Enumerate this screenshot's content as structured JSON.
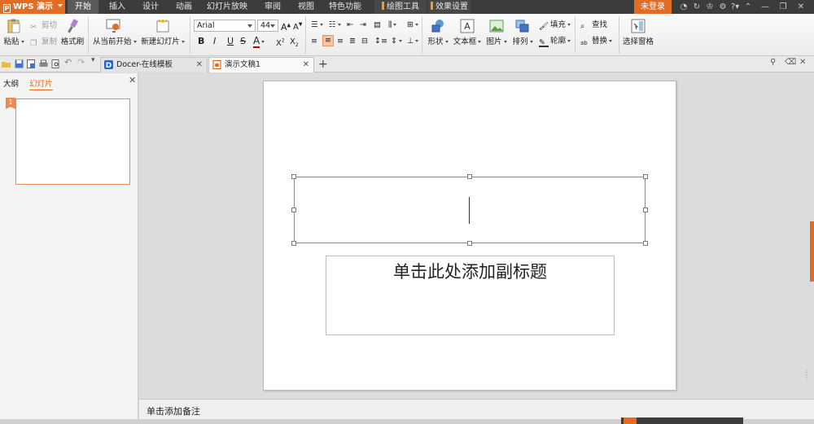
{
  "app": {
    "name": "WPS 演示"
  },
  "menu": {
    "tabs": [
      "开始",
      "插入",
      "设计",
      "动画",
      "幻灯片放映",
      "审阅",
      "视图",
      "特色功能"
    ],
    "tool_tabs": [
      "绘图工具",
      "效果设置"
    ],
    "login": "未登录"
  },
  "ribbon": {
    "paste": "粘贴",
    "cut": "剪切",
    "copy": "复制",
    "format_painter": "格式刷",
    "from_current": "从当前开始",
    "new_slide": "新建幻灯片",
    "font_name": "Arial",
    "font_size": "44",
    "shape": "形状",
    "textbox": "文本框",
    "picture": "图片",
    "arrange": "排列",
    "fill": "填充",
    "outline": "轮廓",
    "find": "查找",
    "replace": "替换",
    "selection_pane": "选择窗格"
  },
  "doc_tabs": [
    {
      "label": "Docer-在线模板"
    },
    {
      "label": "演示文稿1"
    }
  ],
  "left_panel": {
    "tab_outline": "大纲",
    "tab_slides": "幻灯片",
    "slide_number": "1"
  },
  "slide": {
    "subtitle_placeholder": "单击此处添加副标题"
  },
  "notes": {
    "placeholder": "单击添加备注"
  },
  "colors": {
    "accent": "#e36c24",
    "menubar": "#3c3c3c"
  }
}
